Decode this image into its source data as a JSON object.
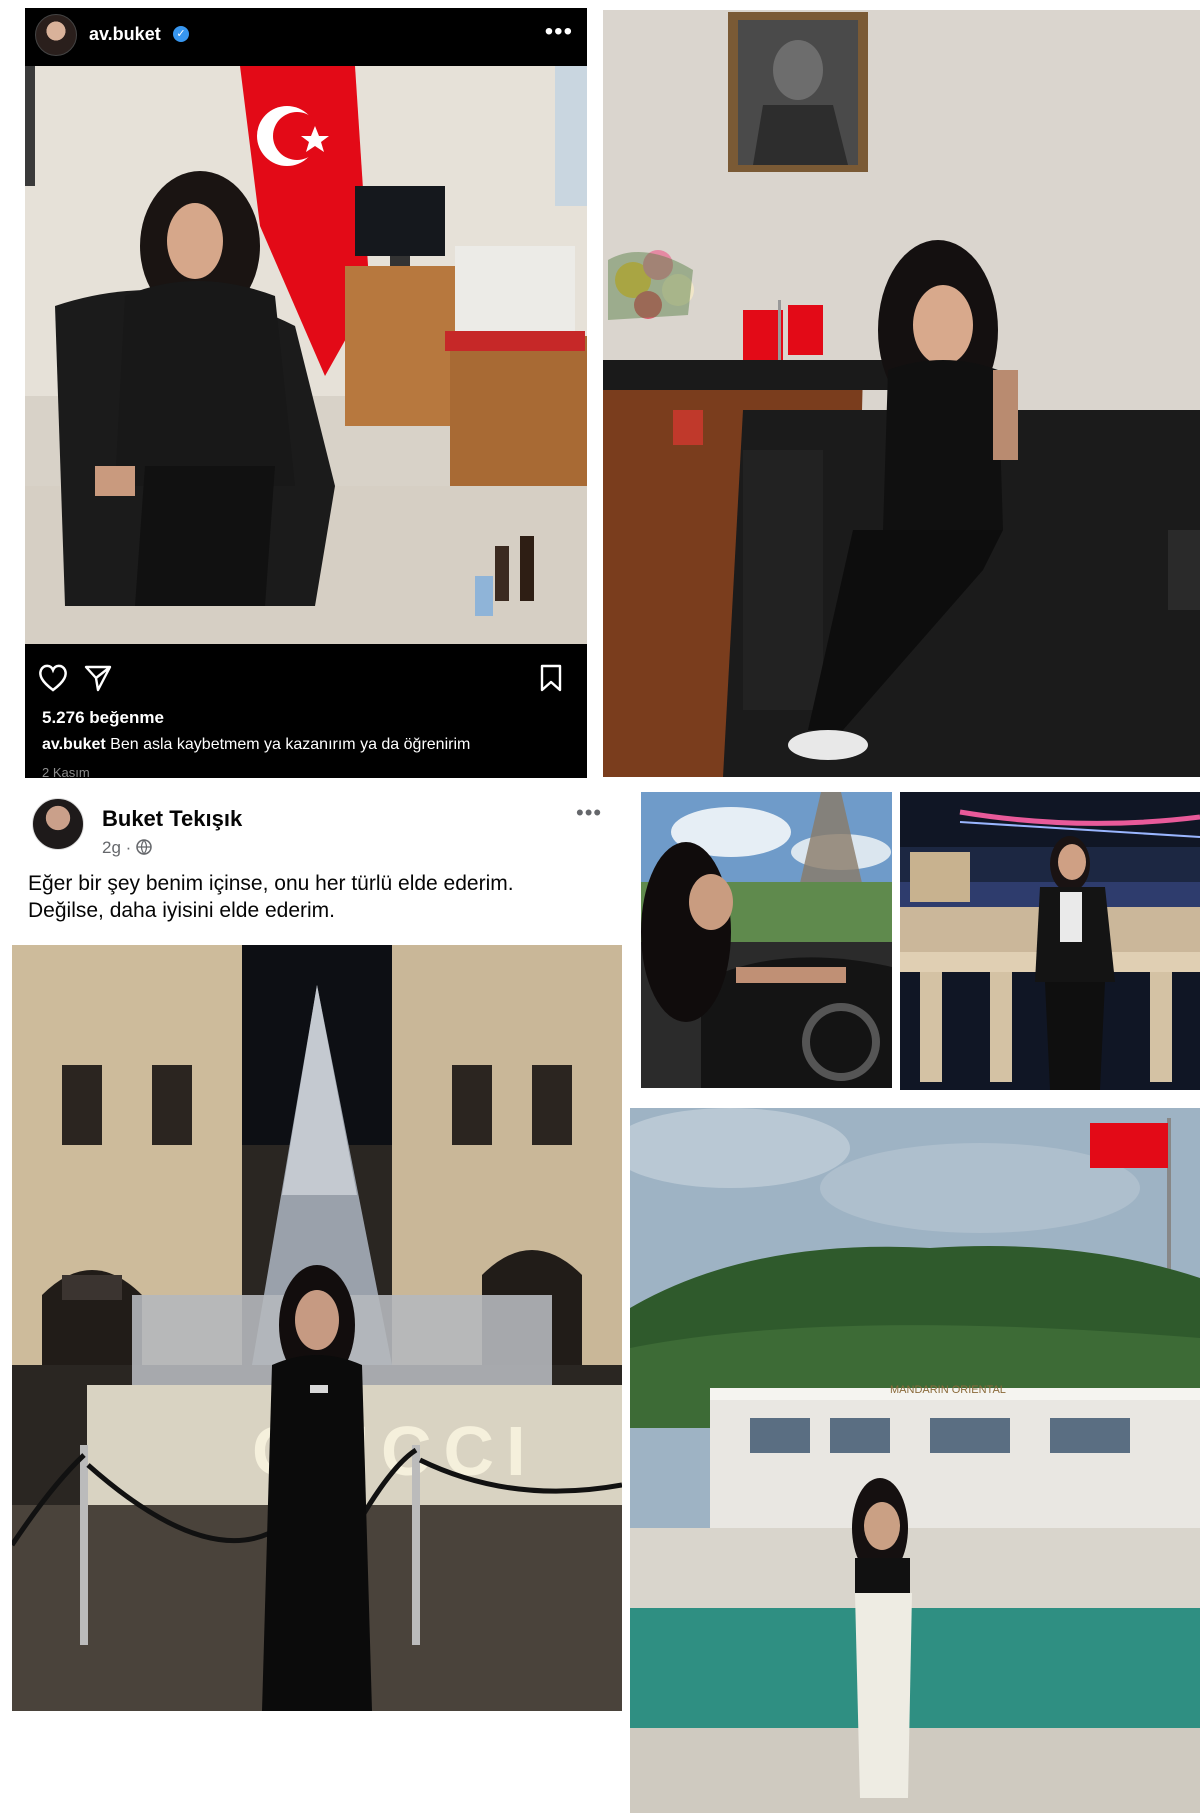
{
  "instagram": {
    "username": "av.buket",
    "more": "•••",
    "likes": "5.276 beğenme",
    "caption_username": "av.buket",
    "caption_text": " Ben asla kaybetmem ya kazanırım ya da öğrenirim",
    "date": "2 Kasım",
    "icons": [
      "heart-icon",
      "share-icon",
      "bookmark-icon",
      "verified-icon"
    ]
  },
  "facebook": {
    "name": "Buket Tekışık",
    "meta": "2g · ",
    "more": "•••",
    "post_text_line1": "Eğer bir şey benim içinse, onu her türlü elde ederim.",
    "post_text_line2": "Değilse, daha iyisini elde ederim.",
    "icons": [
      "globe-icon",
      "more-icon"
    ]
  },
  "photos": {
    "gucci_sign": "GUCCI",
    "hotel_sign": "MANDARIN ORIENTAL"
  },
  "colors": {
    "ig_bg": "#000000",
    "verified_blue": "#3897f0",
    "flag_red": "#e30a17",
    "fb_text": "#050505",
    "fb_meta": "#65676b"
  }
}
